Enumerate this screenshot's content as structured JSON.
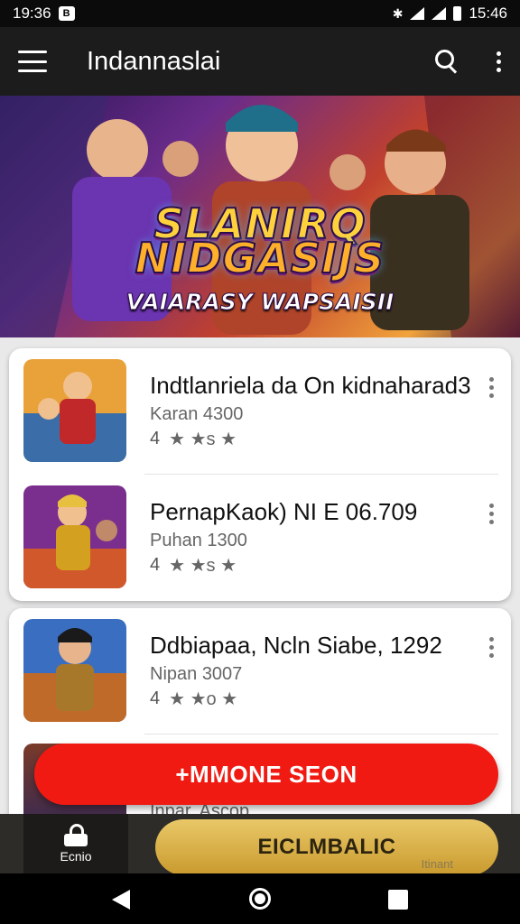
{
  "status_bar": {
    "time_left": "19:36",
    "time_right": "15:46",
    "app_badge": "B"
  },
  "app_bar": {
    "title": "Indannaslai"
  },
  "banner": {
    "title_line1": "SLANIRQ",
    "title_line2": "NIDGASIJS",
    "subtitle": "VAIARASY WAPSAISII"
  },
  "list": {
    "items": [
      {
        "title": "Indtlanriela da On kidnaharad3",
        "subtitle": "Karan 4300",
        "rating": "4",
        "stars": "★ ★s ★"
      },
      {
        "title": "PernapKaok) NI E 06.709",
        "subtitle": "Puhan 1300",
        "rating": "4",
        "stars": "★ ★s ★"
      },
      {
        "title": "Ddbiapaa, Ncln Siabe, 1292",
        "subtitle": "Nipan 3007",
        "rating": "4",
        "stars": "★ ★o ★"
      }
    ],
    "peek_subtitle": "Inpar. Ascop"
  },
  "fab": {
    "label": "+MMONE SEON"
  },
  "bottom_nav": {
    "tab_label": "Ecnio",
    "button_label": "EICLMBALIC",
    "right_label": "Itinant"
  },
  "icons": {
    "menu": "menu-icon",
    "search": "search-icon",
    "more": "more-vertical-icon",
    "lock": "lock-icon",
    "back": "back-icon",
    "home": "home-icon",
    "recent": "recent-apps-icon"
  },
  "colors": {
    "fab": "#f01a12",
    "gold_button": "#d8b04a",
    "app_bar": "#1c1c1c"
  }
}
